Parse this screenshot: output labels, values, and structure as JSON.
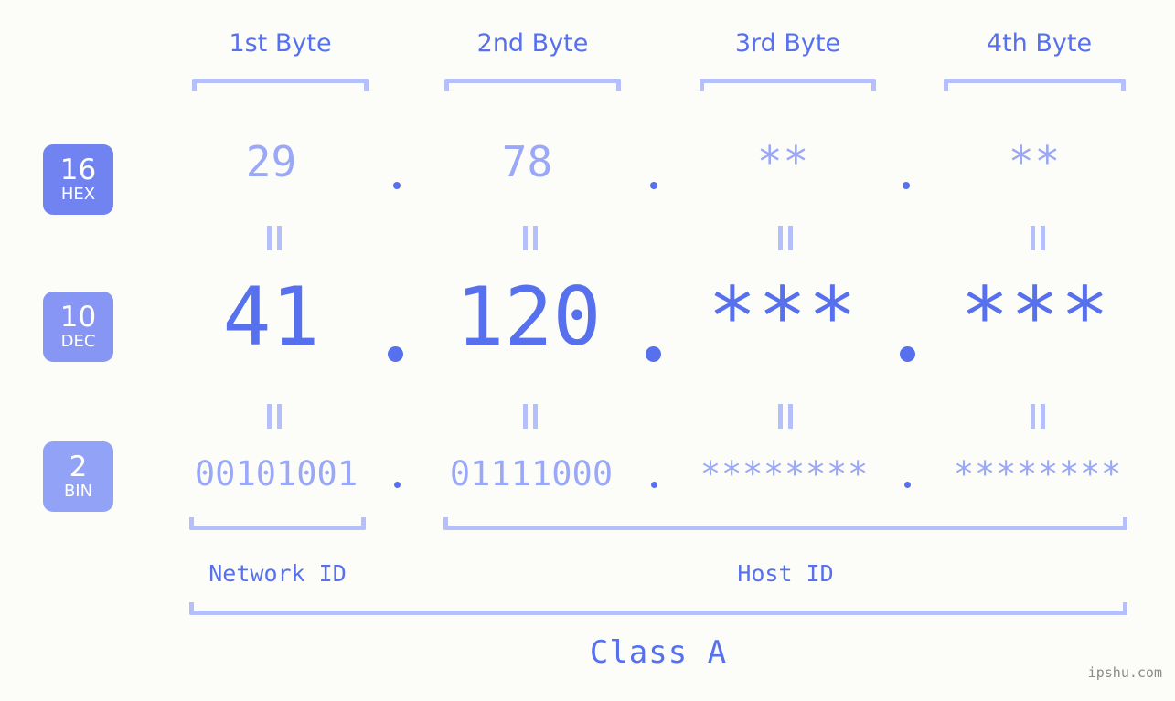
{
  "background_color": "#fcfdf9",
  "accent_color": "#5670ee",
  "accent_light_color": "#9aa8f7",
  "bracket_color": "#b4bffb",
  "byte_headers": [
    {
      "label": "1st Byte"
    },
    {
      "label": "2nd Byte"
    },
    {
      "label": "3rd Byte"
    },
    {
      "label": "4th Byte"
    }
  ],
  "bases": [
    {
      "number": "16",
      "name": "HEX",
      "color": "#7183f0"
    },
    {
      "number": "10",
      "name": "DEC",
      "color": "#8796f4"
    },
    {
      "number": "2",
      "name": "BIN",
      "color": "#92a2f6"
    }
  ],
  "rows": {
    "hex": {
      "values": [
        "29",
        "78",
        "**",
        "**"
      ],
      "separator": "."
    },
    "dec": {
      "values": [
        "41",
        "120",
        "***",
        "***"
      ],
      "separator": "."
    },
    "bin": {
      "values": [
        "00101001",
        "01111000",
        "********",
        "********"
      ],
      "separator": "."
    }
  },
  "equals_symbol": "=",
  "segments": {
    "network_id": "Network ID",
    "host_id": "Host ID",
    "class": "Class A"
  },
  "watermark": "ipshu.com"
}
